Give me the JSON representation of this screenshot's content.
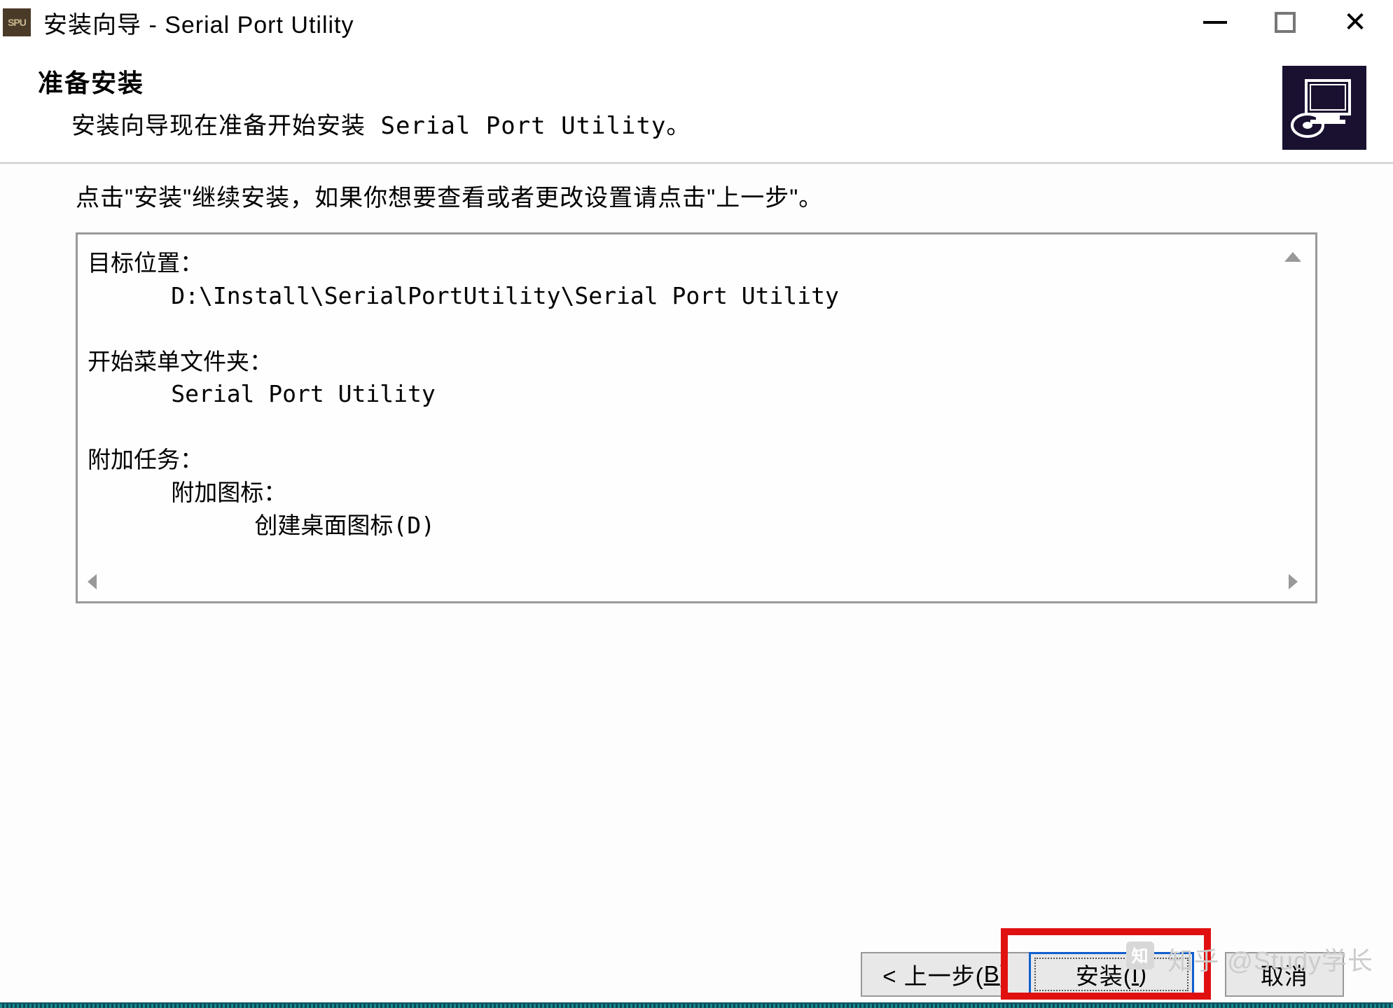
{
  "titlebar": {
    "icon_text": "SPU",
    "title": "安装向导 - Serial Port Utility"
  },
  "header": {
    "title": "准备安装",
    "subtitle": "安装向导现在准备开始安装 Serial Port Utility。"
  },
  "instruction": "点击\"安装\"继续安装，如果你想要查看或者更改设置请点击\"上一步\"。",
  "summary": {
    "target_location_label": "目标位置：",
    "target_location_value": "D:\\Install\\SerialPortUtility\\Serial Port Utility",
    "start_menu_label": "开始菜单文件夹：",
    "start_menu_value": "Serial Port Utility",
    "additional_tasks_label": "附加任务：",
    "additional_icons_label": "附加图标：",
    "create_desktop_icon": "创建桌面图标(D)"
  },
  "buttons": {
    "back_prefix": "< 上一步(",
    "back_hotkey": "B",
    "back_suffix": ")",
    "install_prefix": "安装(",
    "install_hotkey": "I",
    "install_suffix": ")",
    "cancel": "取消"
  },
  "watermark": "知乎 @Study学长"
}
